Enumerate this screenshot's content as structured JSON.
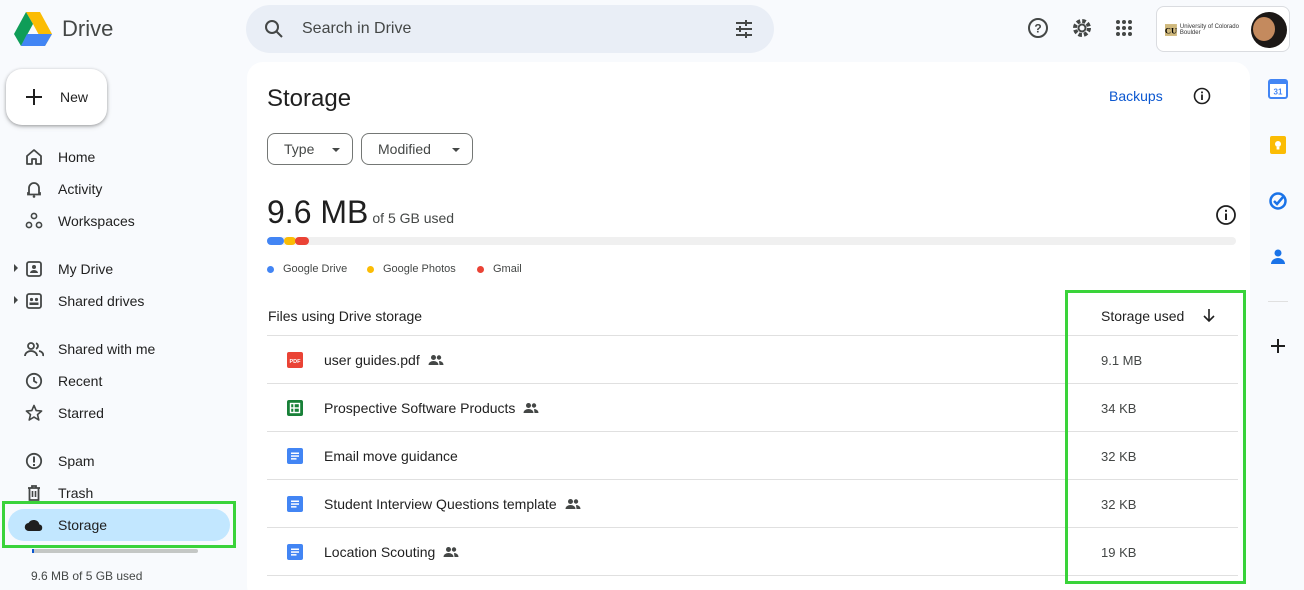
{
  "app": {
    "name": "Drive"
  },
  "search": {
    "placeholder": "Search in Drive"
  },
  "account": {
    "org_name": "University of Colorado Boulder"
  },
  "sidebar": {
    "new_label": "New",
    "items": [
      {
        "label": "Home",
        "icon": "home-icon"
      },
      {
        "label": "Activity",
        "icon": "bell-icon"
      },
      {
        "label": "Workspaces",
        "icon": "workspaces-icon"
      },
      {
        "label": "My Drive",
        "icon": "my-drive-icon"
      },
      {
        "label": "Shared drives",
        "icon": "shared-drives-icon"
      },
      {
        "label": "Shared with me",
        "icon": "people-icon"
      },
      {
        "label": "Recent",
        "icon": "clock-icon"
      },
      {
        "label": "Starred",
        "icon": "star-icon"
      },
      {
        "label": "Spam",
        "icon": "spam-icon"
      },
      {
        "label": "Trash",
        "icon": "trash-icon"
      },
      {
        "label": "Storage",
        "icon": "cloud-icon",
        "active": true
      }
    ],
    "quota_text": "9.6 MB of 5 GB used",
    "quota_fraction": 0.0019
  },
  "main": {
    "title": "Storage",
    "backups_label": "Backups",
    "filters": [
      {
        "label": "Type"
      },
      {
        "label": "Modified"
      }
    ],
    "usage": {
      "amount": "9.6 MB",
      "suffix": "of 5 GB used"
    },
    "legend": [
      {
        "label": "Google Drive",
        "color": "#4285f4"
      },
      {
        "label": "Google Photos",
        "color": "#fbbc04"
      },
      {
        "label": "Gmail",
        "color": "#ea4335"
      }
    ],
    "table": {
      "col_name": "Files using Drive storage",
      "col_size": "Storage used",
      "rows": [
        {
          "name": "user guides.pdf",
          "type": "pdf",
          "shared": true,
          "size": "9.1 MB"
        },
        {
          "name": "Prospective Software Products",
          "type": "sheets",
          "shared": true,
          "size": "34 KB"
        },
        {
          "name": "Email move guidance",
          "type": "docs",
          "shared": false,
          "size": "32 KB"
        },
        {
          "name": "Student Interview Questions template",
          "type": "docs",
          "shared": true,
          "size": "32 KB"
        },
        {
          "name": "Location Scouting",
          "type": "docs",
          "shared": true,
          "size": "19 KB"
        }
      ]
    }
  },
  "colors": {
    "accent": "#0b57d0",
    "active_nav": "#c2e7ff",
    "highlight": "#3ad33a",
    "pdf": "#ea4335",
    "sheets": "#188038",
    "docs": "#4285f4"
  }
}
